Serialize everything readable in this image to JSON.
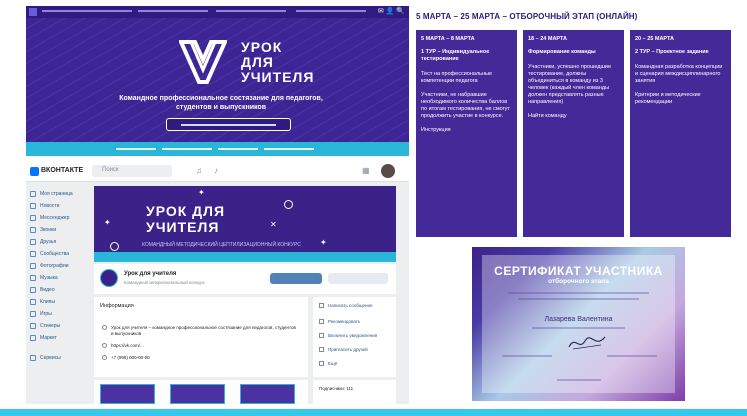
{
  "heading": "5 МАРТА – 25 МАРТА – ОТБОРОЧНЫЙ ЭТАП (ОНЛАЙН)",
  "site": {
    "brand": "УРОК ДЛЯ УЧИТЕЛЯ",
    "subtitle": "Командное профессиональное состязание для педагогов, студентов и выпускников",
    "icons": "✉ 👤 🔍"
  },
  "vk": {
    "logo": "ВКОНТАКТЕ",
    "search_placeholder": "Поиск",
    "sidebar": [
      "Моя страница",
      "Новости",
      "Мессенджер",
      "Звонки",
      "Друзья",
      "Сообщества",
      "Фотографии",
      "Музыка",
      "Видео",
      "Клипы",
      "Игры",
      "Стикеры",
      "Маркет",
      "Сервисы"
    ],
    "cover_title": "УРОК ДЛЯ УЧИТЕЛЯ",
    "cover_sub": "КОМАНДНЫЙ МЕТОДИЧЕСКИЙ ЦЕПТИЛИЗАЦИОННЫЙ КОНКУРС",
    "group_name": "Урок для учителя",
    "group_desc": "Командный межрегиональный конкурс",
    "info_title": "Информация",
    "info_rows": [
      "Урок для учителя – командное профессиональное состязание для педагогов, студентов и выпускников",
      "https://vk.com/...",
      "+7 (999) 000-00-00"
    ],
    "right_rows": [
      "Написать сообщение",
      "Рекомендовать",
      "Включить уведомления",
      "Пригласить друзей",
      "Ещё"
    ],
    "members": "Подписчики: 111"
  },
  "cards": [
    {
      "date": "5 МАРТА – 8 МАРТА",
      "title": "1 ТУР – Индивидуальное тестирование",
      "texts": [
        "Тест на профессиональные компетенции педагога",
        "Участники, не набравшие необходимого количества баллов по итогам тестирования, не смогут продолжить участие в конкурсе.",
        "Инструкция"
      ]
    },
    {
      "date": "18 – 24 МАРТА",
      "title": "Формирование команды",
      "texts": [
        "Участники, успешно прошедшие тестирование, должны объединиться в команду из 3 человек (каждый член команды должен представлять разные направления)",
        "Найти команду"
      ]
    },
    {
      "date": "20 – 25 МАРТА",
      "title": "2 ТУР – Проектное задание",
      "texts": [
        "Командная разработка концепции и сценария междисциплинарного занятия",
        "Критерии и методические рекомендации"
      ]
    }
  ],
  "certificate": {
    "title": "СЕРТИФИКАТ УЧАСТНИКА",
    "subtitle": "отборочного этапа",
    "name": "Лазарева Валентина"
  },
  "colors": {
    "primary": "#442a98",
    "accent": "#29b6d9",
    "vk_blue": "#0077ff"
  }
}
